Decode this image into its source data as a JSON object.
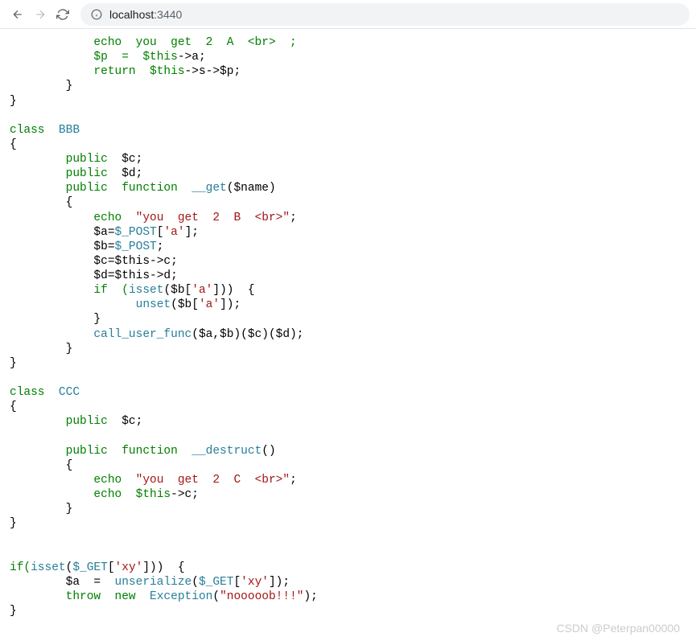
{
  "browser": {
    "url_host": "localhost",
    "url_port": ":3440"
  },
  "code": {
    "l1": "            echo  you  get  2  A  <br>  ;",
    "l2_a": "            $p  =  $this",
    "l2_b": "->a;",
    "l3_a": "            return  $this",
    "l3_b": "->s->$p;",
    "l4": "        }",
    "l5": "}",
    "l6": "",
    "l7_a": "class  ",
    "l7_b": "BBB",
    "l8": "{",
    "l9_a": "        public  ",
    "l9_b": "$c;",
    "l10_a": "        public  ",
    "l10_b": "$d;",
    "l11_a": "        public  function  ",
    "l11_b": "__get",
    "l11_c": "($name)",
    "l12": "        {",
    "l13_a": "            echo  ",
    "l13_b": "\"you  get  2  B  <br>\"",
    "l13_c": ";",
    "l14_a": "            $a=",
    "l14_b": "$_POST",
    "l14_c": "[",
    "l14_d": "'a'",
    "l14_e": "];",
    "l15_a": "            $b=",
    "l15_b": "$_POST",
    "l15_c": ";",
    "l16_a": "            $c=$this",
    "l16_b": "->c;",
    "l17_a": "            $d=$this",
    "l17_b": "->d;",
    "l18_a": "            if  (",
    "l18_b": "isset",
    "l18_c": "($b[",
    "l18_d": "'a'",
    "l18_e": "]))  {",
    "l19_a": "                  unset",
    "l19_b": "($b[",
    "l19_c": "'a'",
    "l19_d": "]);",
    "l20": "            }",
    "l21_a": "            call_user_func",
    "l21_b": "($a,$b)($c)($d);",
    "l22": "        }",
    "l23": "}",
    "l24": "",
    "l25_a": "class  ",
    "l25_b": "CCC",
    "l26": "{",
    "l27_a": "        public  ",
    "l27_b": "$c;",
    "l28": "",
    "l29_a": "        public  function  ",
    "l29_b": "__destruct",
    "l29_c": "()",
    "l30": "        {",
    "l31_a": "            echo  ",
    "l31_b": "\"you  get  2  C  <br>\"",
    "l31_c": ";",
    "l32_a": "            echo  $this",
    "l32_b": "->c;",
    "l33": "        }",
    "l34": "}",
    "l35": "",
    "l36": "",
    "l37_a": "if(",
    "l37_b": "isset",
    "l37_c": "(",
    "l37_d": "$_GET",
    "l37_e": "[",
    "l37_f": "'xy'",
    "l37_g": "]))  {",
    "l38_a": "        $a  =  ",
    "l38_b": "unserialize",
    "l38_c": "(",
    "l38_d": "$_GET",
    "l38_e": "[",
    "l38_f": "'xy'",
    "l38_g": "]);",
    "l39_a": "        throw  new  ",
    "l39_b": "Exception",
    "l39_c": "(",
    "l39_d": "\"nooooob!!!\"",
    "l39_e": ");",
    "l40": "}"
  },
  "watermark": "CSDN @Peterpan00000"
}
